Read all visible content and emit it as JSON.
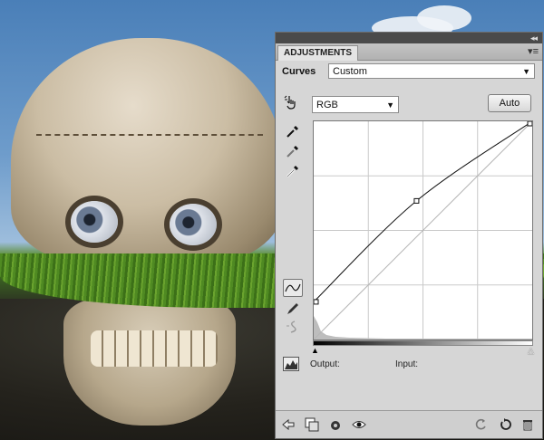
{
  "panel": {
    "tab_label": "ADJUSTMENTS",
    "collapse_glyph": "◂◂",
    "menu_glyph": "▾≡",
    "curves_label": "Curves",
    "preset_value": "Custom",
    "channel_value": "RGB",
    "auto_label": "Auto",
    "output_label": "Output:",
    "input_label": "Input:"
  },
  "tools": {
    "on_image_adjust_icon": "hand-pointer-icon",
    "eyedroppers": [
      "black-point-eyedropper-icon",
      "gray-point-eyedropper-icon",
      "white-point-eyedropper-icon"
    ],
    "edit_points_icon": "curve-tool-icon",
    "draw_icon": "pencil-icon",
    "smooth_icon": "smooth-curve-icon"
  },
  "bottom_bar": {
    "icons": [
      "back-arrow-icon",
      "expand-view-icon",
      "clip-layer-icon",
      "visibility-eye-icon",
      "previous-state-icon",
      "reset-icon",
      "trash-icon"
    ]
  },
  "curve": {
    "points": [
      [
        0,
        44
      ],
      [
        120,
        162
      ],
      [
        255,
        255
      ]
    ]
  },
  "colors": {
    "panel_bg": "#d6d6d6",
    "title_bar": "#4a4a4a"
  }
}
